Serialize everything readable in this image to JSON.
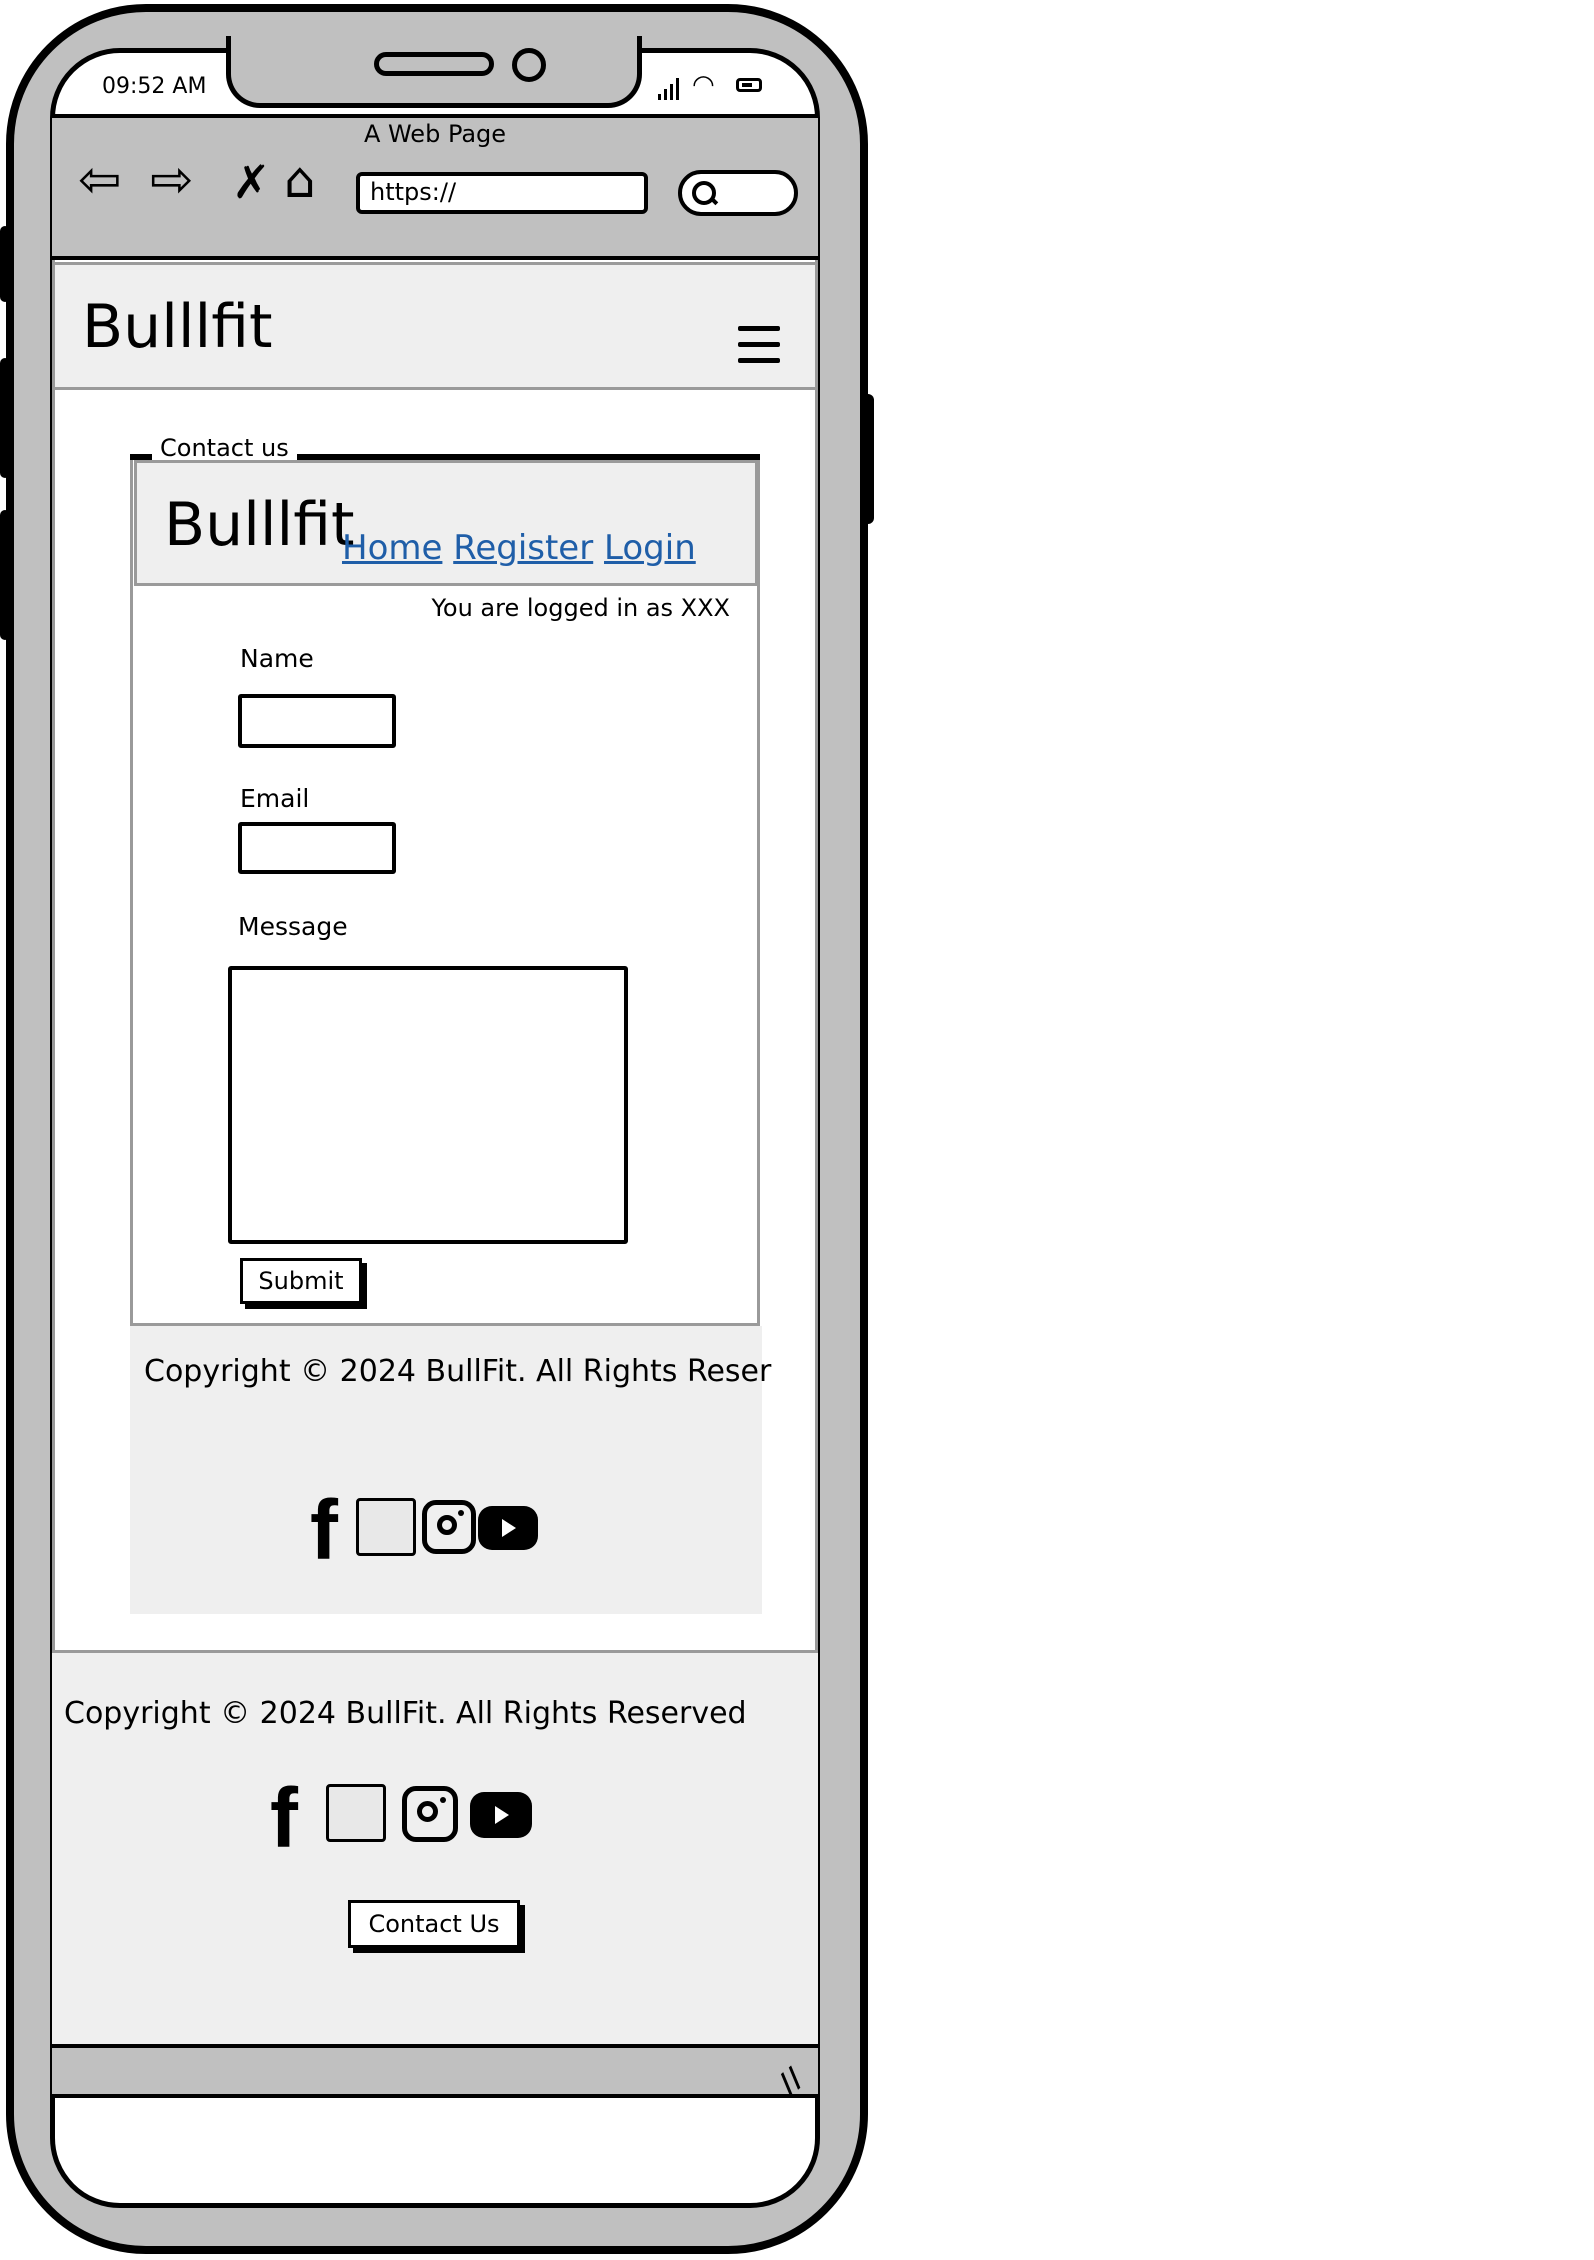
{
  "status": {
    "time": "09:52 AM"
  },
  "browser": {
    "page_title": "A Web Page",
    "url": "https://",
    "back_icon": "arrow-left-icon",
    "forward_icon": "arrow-right-icon",
    "stop_icon": "x-icon",
    "home_icon": "home-icon",
    "search_icon": "search-icon"
  },
  "site": {
    "brand": "Bulllfit",
    "menu_icon": "hamburger-icon"
  },
  "contact_group": {
    "label": "Contact us",
    "inner_brand": "Bulllfit",
    "nav": [
      {
        "label": "Home"
      },
      {
        "label": "Register"
      },
      {
        "label": "Login"
      }
    ],
    "logged_in_text": "You are logged in as XXX",
    "form": {
      "name_label": "Name",
      "email_label": "Email",
      "message_label": "Message",
      "submit_label": "Submit"
    },
    "footer_copyright": "Copyright © 2024 BullFit. All Rights Reser"
  },
  "site_footer": {
    "copyright": "Copyright © 2024 BullFit. All Rights Reserved",
    "contact_button": "Contact Us"
  },
  "social_icons": [
    "facebook-icon",
    "image-placeholder-icon",
    "instagram-icon",
    "youtube-icon"
  ]
}
